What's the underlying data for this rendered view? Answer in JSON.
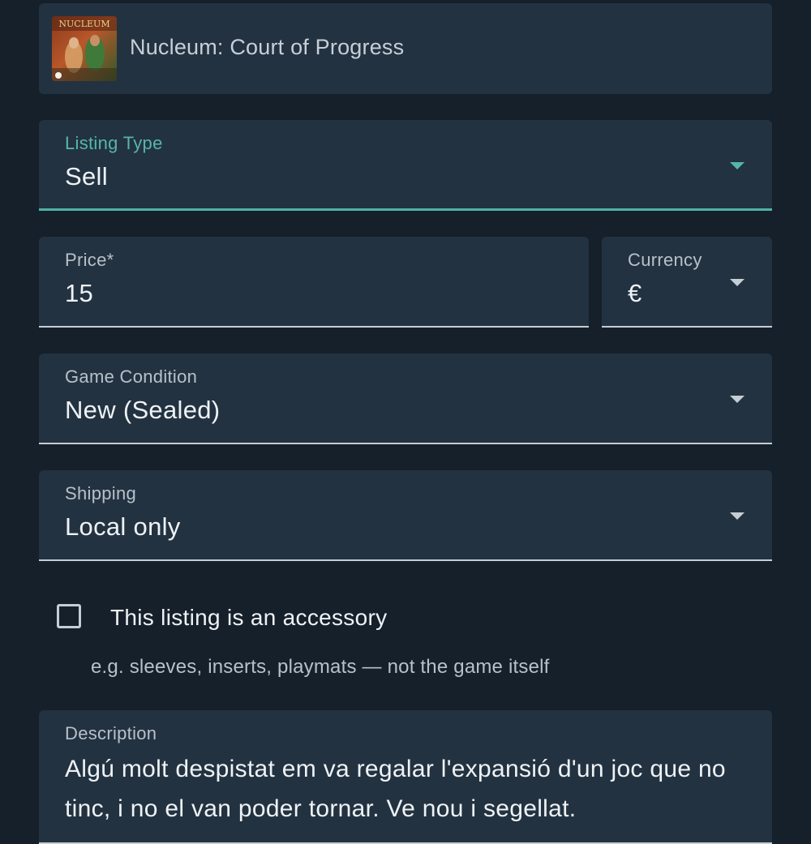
{
  "game": {
    "title": "Nucleum: Court of Progress",
    "thumbnail_text": "NUCLEUM"
  },
  "listing_type": {
    "label": "Listing Type",
    "value": "Sell"
  },
  "price": {
    "label": "Price*",
    "value": "15"
  },
  "currency": {
    "label": "Currency",
    "value": "€"
  },
  "condition": {
    "label": "Game Condition",
    "value": "New (Sealed)"
  },
  "shipping": {
    "label": "Shipping",
    "value": "Local only"
  },
  "accessory": {
    "label": "This listing is an accessory",
    "hint": "e.g. sleeves, inserts, playmats — not the game itself",
    "checked": false
  },
  "description": {
    "label": "Description",
    "value": "Algú molt despistat em va regalar l'expansió d'un joc que no tinc, i no el van poder tornar. Ve nou i segellat."
  },
  "colors": {
    "background": "#16202a",
    "surface": "#233240",
    "accent": "#4fb1a5"
  }
}
